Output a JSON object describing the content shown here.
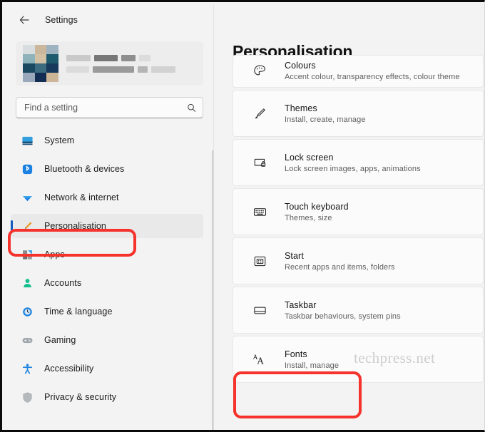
{
  "window": {
    "app_title": "Settings",
    "back_icon": "back-arrow-icon"
  },
  "sidebar": {
    "profile": {
      "avatar_icon": "user-avatar-blurred",
      "name_redacted": true,
      "email_redacted": true
    },
    "search": {
      "placeholder": "Find a setting",
      "value": "",
      "icon": "search-icon"
    },
    "items": [
      {
        "label": "System",
        "icon": "monitor-icon",
        "selected": false
      },
      {
        "label": "Bluetooth & devices",
        "icon": "bluetooth-icon",
        "selected": false
      },
      {
        "label": "Network & internet",
        "icon": "wifi-icon",
        "selected": false
      },
      {
        "label": "Personalisation",
        "icon": "paintbrush-icon",
        "selected": true
      },
      {
        "label": "Apps",
        "icon": "apps-grid-icon",
        "selected": false
      },
      {
        "label": "Accounts",
        "icon": "person-icon",
        "selected": false
      },
      {
        "label": "Time & language",
        "icon": "clock-icon",
        "selected": false
      },
      {
        "label": "Gaming",
        "icon": "gamepad-icon",
        "selected": false
      },
      {
        "label": "Accessibility",
        "icon": "accessibility-icon",
        "selected": false
      },
      {
        "label": "Privacy & security",
        "icon": "shield-icon",
        "selected": false
      }
    ]
  },
  "main": {
    "page_title": "Personalisation",
    "cards": [
      {
        "title": "Colours",
        "subtitle": "Accent colour, transparency effects, colour theme",
        "icon": "palette-icon"
      },
      {
        "title": "Themes",
        "subtitle": "Install, create, manage",
        "icon": "paintbrush-icon"
      },
      {
        "title": "Lock screen",
        "subtitle": "Lock screen images, apps, animations",
        "icon": "lock-screen-icon"
      },
      {
        "title": "Touch keyboard",
        "subtitle": "Themes, size",
        "icon": "keyboard-icon"
      },
      {
        "title": "Start",
        "subtitle": "Recent apps and items, folders",
        "icon": "start-menu-icon"
      },
      {
        "title": "Taskbar",
        "subtitle": "Taskbar behaviours, system pins",
        "icon": "taskbar-icon"
      },
      {
        "title": "Fonts",
        "subtitle": "Install, manage",
        "icon": "fonts-aa-icon"
      }
    ]
  },
  "annotations": {
    "colour": "#f6322c",
    "highlight_sidebar_item": "Personalisation",
    "highlight_card": "Fonts"
  },
  "watermark": {
    "text": "techpress.net"
  }
}
